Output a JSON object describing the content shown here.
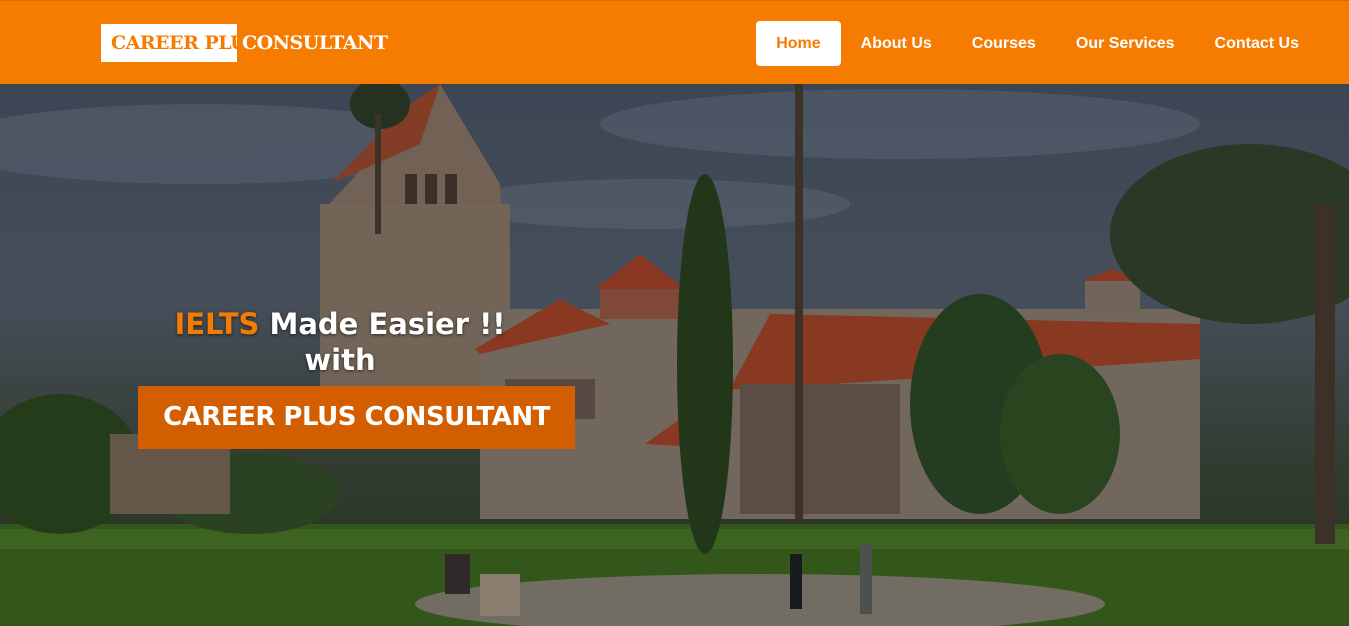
{
  "logo": {
    "box_text": "CAREER PLUS",
    "text": "CONSULTANT"
  },
  "nav": {
    "items": [
      {
        "label": "Home",
        "active": true
      },
      {
        "label": "About Us"
      },
      {
        "label": "Courses"
      },
      {
        "label": "Our Services"
      },
      {
        "label": "Contact Us"
      }
    ]
  },
  "hero": {
    "highlight": "IELTS",
    "title_rest": " Made Easier !!",
    "title_line2": "with",
    "cta_label": "CAREER PLUS CONSULTANT"
  },
  "colors": {
    "accent": "#f57c00",
    "cta": "#d35e00"
  }
}
